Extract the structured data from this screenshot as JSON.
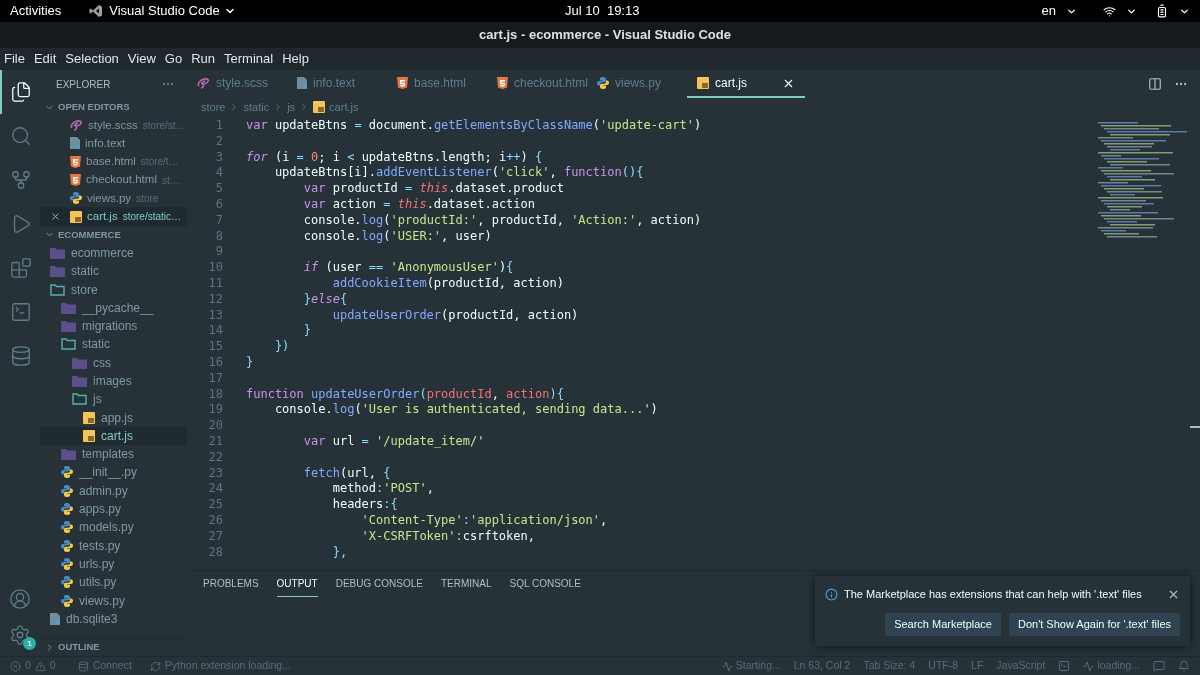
{
  "system_bar": {
    "activities": "Activities",
    "app": "Visual Studio Code",
    "clock": "Jul 10  19:13",
    "language": "en"
  },
  "window": {
    "title": "cart.js - ecommerce - Visual Studio Code"
  },
  "menu": [
    "File",
    "Edit",
    "Selection",
    "View",
    "Go",
    "Run",
    "Terminal",
    "Help"
  ],
  "activity_bar": {
    "items": [
      {
        "kind": "explorer",
        "selected": true
      },
      {
        "kind": "search",
        "selected": false
      },
      {
        "kind": "source_control",
        "selected": false
      },
      {
        "kind": "run",
        "selected": false
      },
      {
        "kind": "extensions",
        "selected": false
      },
      {
        "kind": "terminal",
        "selected": false
      },
      {
        "kind": "database",
        "selected": false
      }
    ],
    "settings_badge": "1"
  },
  "sidebar": {
    "title": "EXPLORER",
    "open_editors": {
      "title": "OPEN EDITORS",
      "expanded": true,
      "items": [
        {
          "name": "style.scss",
          "path": "store/st…",
          "kind": "scss",
          "selected": false
        },
        {
          "name": "info.text",
          "kind": "text",
          "selected": false
        },
        {
          "name": "base.html",
          "path": "store/t…",
          "kind": "html",
          "selected": false
        },
        {
          "name": "checkout.html",
          "path": "st…",
          "kind": "html",
          "selected": false
        },
        {
          "name": "views.py",
          "path": "store",
          "kind": "py",
          "selected": false
        },
        {
          "name": "cart.js",
          "path": "store/static…",
          "kind": "js",
          "selected": true
        }
      ]
    },
    "workspace": {
      "title": "ECOMMERCE",
      "expanded": true,
      "tree": [
        {
          "name": "ecommerce",
          "kind": "folder",
          "expanded": false,
          "selected": false
        },
        {
          "name": "static",
          "kind": "folder",
          "expanded": false,
          "selected": false
        },
        {
          "name": "store",
          "kind": "folder",
          "expanded": true,
          "selected": false,
          "children": [
            {
              "name": "__pycache__",
              "kind": "folder",
              "expanded": false,
              "selected": false
            },
            {
              "name": "migrations",
              "kind": "folder",
              "expanded": false,
              "selected": false
            },
            {
              "name": "static",
              "kind": "folder",
              "expanded": true,
              "selected": false,
              "children": [
                {
                  "name": "css",
                  "kind": "folder",
                  "expanded": false,
                  "selected": false
                },
                {
                  "name": "images",
                  "kind": "folder",
                  "expanded": false,
                  "selected": false
                },
                {
                  "name": "js",
                  "kind": "folder",
                  "expanded": true,
                  "selected": false,
                  "children": [
                    {
                      "name": "app.js",
                      "kind": "js",
                      "selected": false
                    },
                    {
                      "name": "cart.js",
                      "kind": "js",
                      "selected": true
                    }
                  ]
                }
              ]
            },
            {
              "name": "templates",
              "kind": "folder",
              "expanded": false,
              "selected": false
            },
            {
              "name": "__init__.py",
              "kind": "py",
              "selected": false
            },
            {
              "name": "admin.py",
              "kind": "py",
              "selected": false
            },
            {
              "name": "apps.py",
              "kind": "py",
              "selected": false
            },
            {
              "name": "models.py",
              "kind": "py",
              "selected": false
            },
            {
              "name": "tests.py",
              "kind": "py",
              "selected": false
            },
            {
              "name": "urls.py",
              "kind": "py",
              "selected": false
            },
            {
              "name": "utils.py",
              "kind": "py",
              "selected": false
            },
            {
              "name": "views.py",
              "kind": "py",
              "selected": false
            }
          ]
        },
        {
          "name": "db.sqlite3",
          "kind": "text",
          "selected": false
        }
      ]
    },
    "outline": {
      "title": "OUTLINE",
      "expanded": false
    }
  },
  "tabs": [
    {
      "label": "style.scss",
      "kind": "scss",
      "selected": false
    },
    {
      "label": "info.text",
      "kind": "text",
      "selected": false
    },
    {
      "label": "base.html",
      "kind": "html",
      "selected": false
    },
    {
      "label": "checkout.html",
      "kind": "html",
      "selected": false
    },
    {
      "label": "views.py",
      "kind": "py",
      "selected": false
    },
    {
      "label": "cart.js",
      "kind": "js",
      "selected": true
    }
  ],
  "breadcrumb": [
    "store",
    "static",
    "js",
    "cart.js"
  ],
  "code": [
    {
      "number": "1",
      "tokens": [
        {
          "text": "var",
          "kind": "keyword"
        },
        {
          "text": " updateBtns ",
          "kind": "plain"
        },
        {
          "text": "=",
          "kind": "operator"
        },
        {
          "text": " document.",
          "kind": "plain"
        },
        {
          "text": "getElementsByClassName",
          "kind": "function"
        },
        {
          "text": "(",
          "kind": "plain"
        },
        {
          "text": "'update-cart'",
          "kind": "string"
        },
        {
          "text": ")",
          "kind": "plain"
        }
      ]
    },
    {
      "number": "2"
    },
    {
      "number": "3",
      "tokens": [
        {
          "text": "for",
          "kind": "control"
        },
        {
          "text": " (i ",
          "kind": "plain"
        },
        {
          "text": "=",
          "kind": "operator"
        },
        {
          "text": " 0",
          "kind": "number"
        },
        {
          "text": "; i ",
          "kind": "plain"
        },
        {
          "text": "<",
          "kind": "operator"
        },
        {
          "text": " updateBtns.length; i",
          "kind": "plain"
        },
        {
          "text": "++",
          "kind": "operator"
        },
        {
          "text": ") ",
          "kind": "plain"
        },
        {
          "text": "{",
          "kind": "operator"
        }
      ]
    },
    {
      "number": "4",
      "tokens": [
        {
          "text": "    updateBtns[i].",
          "kind": "plain"
        },
        {
          "text": "addEventListener",
          "kind": "function"
        },
        {
          "text": "(",
          "kind": "plain"
        },
        {
          "text": "'click'",
          "kind": "string"
        },
        {
          "text": ", ",
          "kind": "plain"
        },
        {
          "text": "function",
          "kind": "keyword"
        },
        {
          "text": "(){",
          "kind": "operator"
        }
      ]
    },
    {
      "number": "5",
      "tokens": [
        {
          "text": "        var",
          "kind": "keyword"
        },
        {
          "text": " productId ",
          "kind": "plain"
        },
        {
          "text": "=",
          "kind": "operator"
        },
        {
          "text": " this",
          "kind": "this"
        },
        {
          "text": ".dataset.product",
          "kind": "plain"
        }
      ]
    },
    {
      "number": "6",
      "tokens": [
        {
          "text": "        var",
          "kind": "keyword"
        },
        {
          "text": " action ",
          "kind": "plain"
        },
        {
          "text": "=",
          "kind": "operator"
        },
        {
          "text": " this",
          "kind": "this"
        },
        {
          "text": ".dataset.action",
          "kind": "plain"
        }
      ]
    },
    {
      "number": "7",
      "tokens": [
        {
          "text": "        console.",
          "kind": "plain"
        },
        {
          "text": "log",
          "kind": "function"
        },
        {
          "text": "(",
          "kind": "plain"
        },
        {
          "text": "'productId:'",
          "kind": "string"
        },
        {
          "text": ", productId, ",
          "kind": "plain"
        },
        {
          "text": "'Action:'",
          "kind": "string"
        },
        {
          "text": ", action)",
          "kind": "plain"
        }
      ]
    },
    {
      "number": "8",
      "tokens": [
        {
          "text": "        console.",
          "kind": "plain"
        },
        {
          "text": "log",
          "kind": "function"
        },
        {
          "text": "(",
          "kind": "plain"
        },
        {
          "text": "'USER:'",
          "kind": "string"
        },
        {
          "text": ", user)",
          "kind": "plain"
        }
      ]
    },
    {
      "number": "9"
    },
    {
      "number": "10",
      "tokens": [
        {
          "text": "        if",
          "kind": "control"
        },
        {
          "text": " (user ",
          "kind": "plain"
        },
        {
          "text": "==",
          "kind": "operator"
        },
        {
          "text": " 'AnonymousUser'",
          "kind": "string"
        },
        {
          "text": ")",
          "kind": "plain"
        },
        {
          "text": "{",
          "kind": "operator"
        }
      ]
    },
    {
      "number": "11",
      "tokens": [
        {
          "text": "            addCookieItem",
          "kind": "function"
        },
        {
          "text": "(productId, action)",
          "kind": "plain"
        }
      ]
    },
    {
      "number": "12",
      "tokens": [
        {
          "text": "        }",
          "kind": "operator"
        },
        {
          "text": "else",
          "kind": "control"
        },
        {
          "text": "{",
          "kind": "operator"
        }
      ]
    },
    {
      "number": "13",
      "tokens": [
        {
          "text": "            updateUserOrder",
          "kind": "function"
        },
        {
          "text": "(productId, action)",
          "kind": "plain"
        }
      ]
    },
    {
      "number": "14",
      "tokens": [
        {
          "text": "        }",
          "kind": "operator"
        }
      ]
    },
    {
      "number": "15",
      "tokens": [
        {
          "text": "    })",
          "kind": "operator"
        }
      ]
    },
    {
      "number": "16",
      "tokens": [
        {
          "text": "}",
          "kind": "operator"
        }
      ]
    },
    {
      "number": "17"
    },
    {
      "number": "18",
      "tokens": [
        {
          "text": "function",
          "kind": "keyword"
        },
        {
          "text": " updateUserOrder",
          "kind": "function"
        },
        {
          "text": "(",
          "kind": "operator"
        },
        {
          "text": "productId",
          "kind": "parameter"
        },
        {
          "text": ", ",
          "kind": "plain"
        },
        {
          "text": "action",
          "kind": "parameter"
        },
        {
          "text": "){",
          "kind": "operator"
        }
      ]
    },
    {
      "number": "19",
      "tokens": [
        {
          "text": "    console.",
          "kind": "plain"
        },
        {
          "text": "log",
          "kind": "function"
        },
        {
          "text": "(",
          "kind": "plain"
        },
        {
          "text": "'User is authenticated, sending data...'",
          "kind": "string"
        },
        {
          "text": ")",
          "kind": "plain"
        }
      ]
    },
    {
      "number": "20"
    },
    {
      "number": "21",
      "tokens": [
        {
          "text": "        var",
          "kind": "keyword"
        },
        {
          "text": " url ",
          "kind": "plain"
        },
        {
          "text": "=",
          "kind": "operator"
        },
        {
          "text": " '/update_item/'",
          "kind": "string"
        }
      ]
    },
    {
      "number": "22"
    },
    {
      "number": "23",
      "tokens": [
        {
          "text": "        fetch",
          "kind": "function"
        },
        {
          "text": "(url, ",
          "kind": "plain"
        },
        {
          "text": "{",
          "kind": "operator"
        }
      ]
    },
    {
      "number": "24",
      "tokens": [
        {
          "text": "            method",
          "kind": "plain"
        },
        {
          "text": ":",
          "kind": "operator"
        },
        {
          "text": "'POST'",
          "kind": "string"
        },
        {
          "text": ",",
          "kind": "plain"
        }
      ]
    },
    {
      "number": "25",
      "tokens": [
        {
          "text": "            headers",
          "kind": "plain"
        },
        {
          "text": ":{",
          "kind": "operator"
        }
      ]
    },
    {
      "number": "26",
      "tokens": [
        {
          "text": "                'Content-Type'",
          "kind": "string"
        },
        {
          "text": ":",
          "kind": "operator"
        },
        {
          "text": "'application/json'",
          "kind": "string"
        },
        {
          "text": ",",
          "kind": "plain"
        }
      ]
    },
    {
      "number": "27",
      "tokens": [
        {
          "text": "                'X-CSRFToken'",
          "kind": "string"
        },
        {
          "text": ":",
          "kind": "operator"
        },
        {
          "text": "csrftoken,",
          "kind": "plain"
        }
      ]
    },
    {
      "number": "28",
      "tokens": [
        {
          "text": "            },",
          "kind": "operator"
        }
      ]
    }
  ],
  "panel": {
    "tabs": [
      {
        "label": "PROBLEMS",
        "selected": false
      },
      {
        "label": "OUTPUT",
        "selected": true
      },
      {
        "label": "DEBUG CONSOLE",
        "selected": false
      },
      {
        "label": "TERMINAL",
        "selected": false
      },
      {
        "label": "SQL CONSOLE",
        "selected": false
      }
    ]
  },
  "notification": {
    "message": "The Marketplace has extensions that can help with '.text' files",
    "buttons": [
      "Search Marketplace",
      "Don't Show Again for '.text' files"
    ]
  },
  "status_bar": {
    "errors": "0",
    "warnings": "0",
    "connect": "Connect",
    "python": "Python extension loading...",
    "starting": "Starting...",
    "position": "Ln 63, Col 2",
    "tab_size": "Tab Size: 4",
    "encoding": "UTF-8",
    "eol": "LF",
    "language": "JavaScript",
    "loading": "loading..."
  }
}
